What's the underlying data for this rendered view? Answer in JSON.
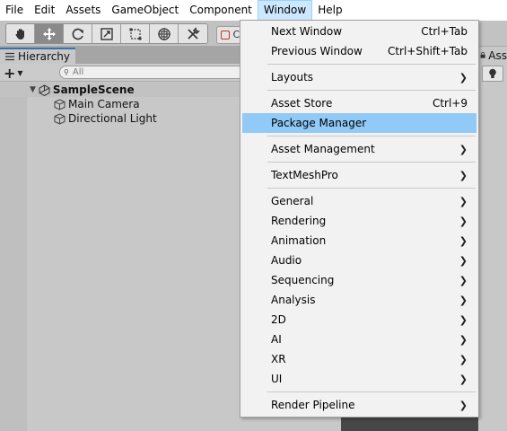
{
  "menubar": {
    "items": [
      "File",
      "Edit",
      "Assets",
      "GameObject",
      "Component",
      "Window",
      "Help"
    ],
    "open_item": "Window"
  },
  "toolbar": {
    "tools": [
      "hand-tool-icon",
      "move-tool-icon",
      "rotate-tool-icon",
      "scale-tool-icon",
      "rect-tool-icon",
      "transform-tool-icon",
      "custom-tool-icon"
    ],
    "active_tool": "move-tool-icon",
    "pivot_label": "C"
  },
  "hierarchy": {
    "tab_label": "Hierarchy",
    "add_label": "+",
    "search_placeholder": "All",
    "scene_name": "SampleScene",
    "objects": [
      "Main Camera",
      "Directional Light"
    ]
  },
  "right_panel": {
    "tab_label": "Ass"
  },
  "window_menu": {
    "items": [
      {
        "label": "Next Window",
        "shortcut": "Ctrl+Tab",
        "submenu": false
      },
      {
        "label": "Previous Window",
        "shortcut": "Ctrl+Shift+Tab",
        "submenu": false
      },
      {
        "label": "Layouts",
        "shortcut": "",
        "submenu": true
      },
      {
        "label": "Asset Store",
        "shortcut": "Ctrl+9",
        "submenu": false
      },
      {
        "label": "Package Manager",
        "shortcut": "",
        "submenu": false,
        "highlighted": true
      },
      {
        "label": "Asset Management",
        "shortcut": "",
        "submenu": true
      },
      {
        "label": "TextMeshPro",
        "shortcut": "",
        "submenu": true
      },
      {
        "label": "General",
        "shortcut": "",
        "submenu": true
      },
      {
        "label": "Rendering",
        "shortcut": "",
        "submenu": true
      },
      {
        "label": "Animation",
        "shortcut": "",
        "submenu": true
      },
      {
        "label": "Audio",
        "shortcut": "",
        "submenu": true
      },
      {
        "label": "Sequencing",
        "shortcut": "",
        "submenu": true
      },
      {
        "label": "Analysis",
        "shortcut": "",
        "submenu": true
      },
      {
        "label": "2D",
        "shortcut": "",
        "submenu": true
      },
      {
        "label": "AI",
        "shortcut": "",
        "submenu": true
      },
      {
        "label": "XR",
        "shortcut": "",
        "submenu": true
      },
      {
        "label": "UI",
        "shortcut": "",
        "submenu": true
      },
      {
        "label": "Render Pipeline",
        "shortcut": "",
        "submenu": true
      }
    ]
  },
  "colors": {
    "highlight": "#91c9f7",
    "menubar_open": "#cce8ff",
    "tab_accent": "#3a72b0"
  }
}
